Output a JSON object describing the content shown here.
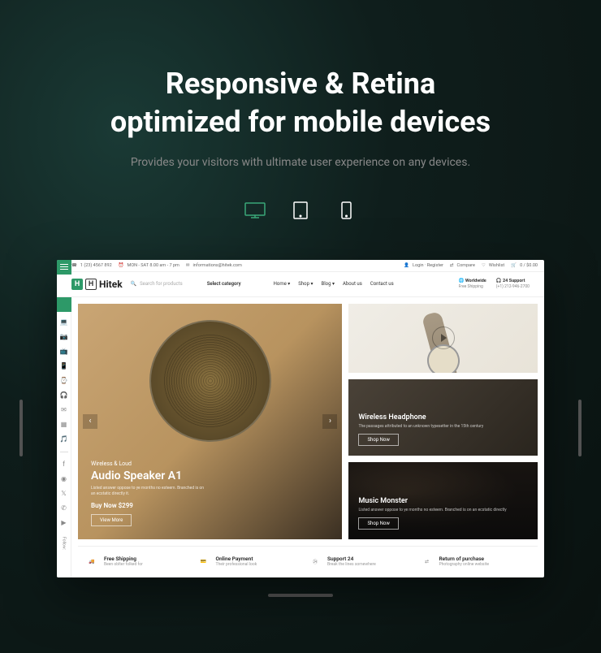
{
  "hero": {
    "title_line1": "Responsive & Retina",
    "title_line2": "optimized for mobile devices",
    "subtitle": "Provides your visitors with ultimate user experience on any devices."
  },
  "topbar": {
    "phone": "1 (23) 4567 892",
    "hours": "MON - SAT 8.00 am - 7 pm",
    "email": "informations@hitek.com",
    "login": "Login · Register",
    "compare": "Compare",
    "wishlist": "Wishlist",
    "cart": "0 / $0.00"
  },
  "logo": "Hitek",
  "search": {
    "placeholder": "Search for products"
  },
  "select_category": "Select category",
  "nav": [
    {
      "label": "Home",
      "drop": true
    },
    {
      "label": "Shop",
      "drop": true
    },
    {
      "label": "Blog",
      "drop": true
    },
    {
      "label": "About us",
      "drop": false
    },
    {
      "label": "Contact us",
      "drop": false
    }
  ],
  "header_right": {
    "worldwide": {
      "title": "Worldwide",
      "sub": "Free Shipping"
    },
    "support": {
      "title": "24 Support",
      "sub": "(+1) 212-946-2700"
    }
  },
  "slider": {
    "sup": "Wireless & Loud",
    "title": "Audio Speaker A1",
    "desc": "Listed answer oppose to ye months no esteem. Branched is on an ecstatic directly it.",
    "price": "Buy Now $299",
    "btn": "View More"
  },
  "tile2": {
    "title": "Wireless Headphone",
    "desc": "The passages attributed to an unknown typesetter in the 15th century",
    "btn": "Shop Now"
  },
  "tile3": {
    "title": "Music Monster",
    "desc": "Listed answer oppose to ye months no esteem. Branched is on an ecstatic directly",
    "btn": "Shop Now"
  },
  "features": [
    {
      "title": "Free Shipping",
      "sub": "Been oblter folked for"
    },
    {
      "title": "Online Payment",
      "sub": "Their professional look"
    },
    {
      "title": "Support 24",
      "sub": "Break the lines somewhere"
    },
    {
      "title": "Return of purchase",
      "sub": "Photography online website"
    }
  ],
  "follow": "Follow:"
}
